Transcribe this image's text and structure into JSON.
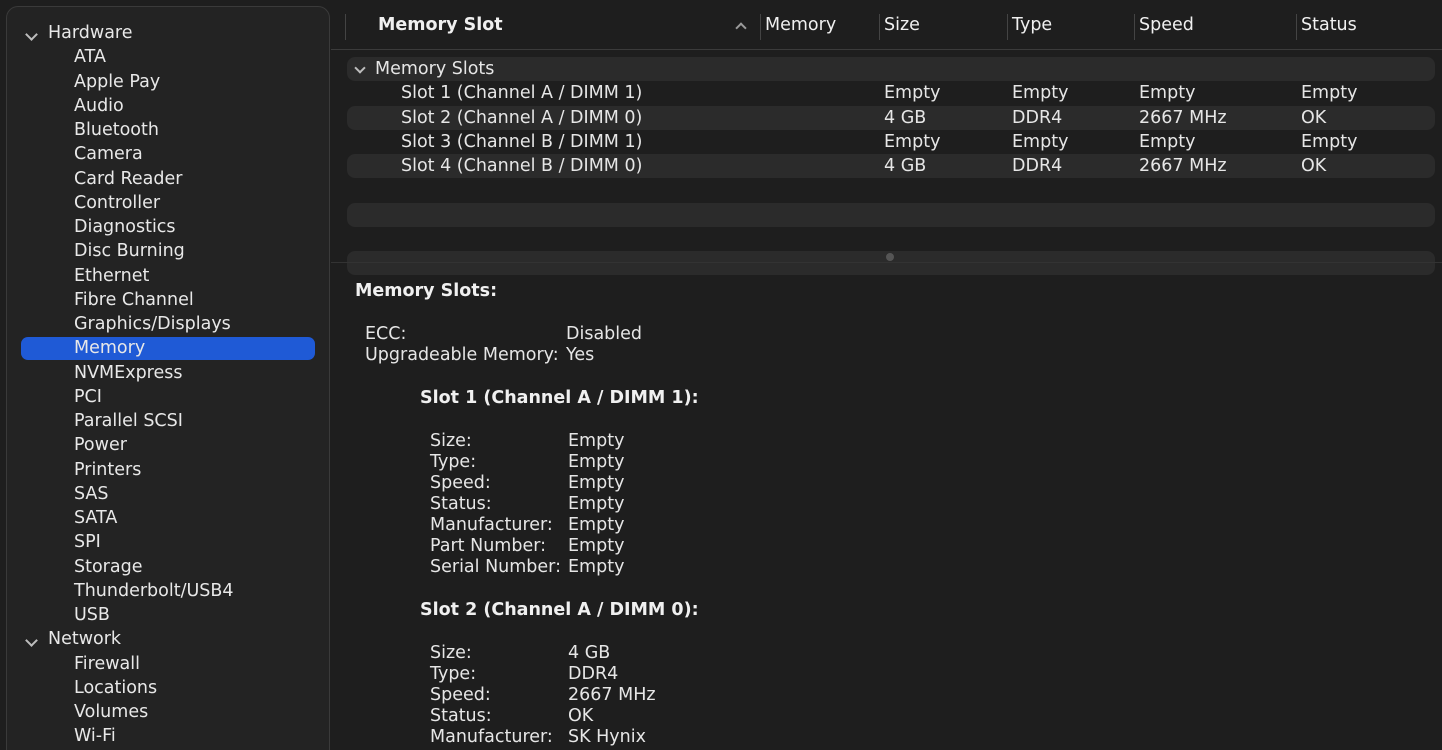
{
  "sidebar": {
    "groups": [
      {
        "label": "Hardware",
        "items": [
          "ATA",
          "Apple Pay",
          "Audio",
          "Bluetooth",
          "Camera",
          "Card Reader",
          "Controller",
          "Diagnostics",
          "Disc Burning",
          "Ethernet",
          "Fibre Channel",
          "Graphics/Displays",
          "Memory",
          "NVMExpress",
          "PCI",
          "Parallel SCSI",
          "Power",
          "Printers",
          "SAS",
          "SATA",
          "SPI",
          "Storage",
          "Thunderbolt/USB4",
          "USB"
        ]
      },
      {
        "label": "Network",
        "items": [
          "Firewall",
          "Locations",
          "Volumes",
          "Wi-Fi"
        ]
      }
    ],
    "selected": "Memory",
    "accent": "#1f5ad6"
  },
  "table": {
    "columns": [
      "Memory Slot",
      "Memory",
      "Size",
      "Type",
      "Speed",
      "Status"
    ],
    "group_label": "Memory Slots",
    "rows": [
      {
        "slot": "Slot 1 (Channel A / DIMM 1)",
        "size": "Empty",
        "type": "Empty",
        "speed": "Empty",
        "status": "Empty"
      },
      {
        "slot": "Slot 2 (Channel A / DIMM 0)",
        "size": "4 GB",
        "type": "DDR4",
        "speed": "2667 MHz",
        "status": "OK"
      },
      {
        "slot": "Slot 3 (Channel B / DIMM 1)",
        "size": "Empty",
        "type": "Empty",
        "speed": "Empty",
        "status": "Empty"
      },
      {
        "slot": "Slot 4 (Channel B / DIMM 0)",
        "size": "4 GB",
        "type": "DDR4",
        "speed": "2667 MHz",
        "status": "OK"
      }
    ]
  },
  "details": {
    "title": "Memory Slots:",
    "summary": [
      {
        "k": "ECC:",
        "v": "Disabled"
      },
      {
        "k": "Upgradeable Memory:",
        "v": "Yes"
      }
    ],
    "slot1": {
      "title": "Slot 1 (Channel A / DIMM 1):",
      "fields": [
        {
          "k": "Size:",
          "v": "Empty"
        },
        {
          "k": "Type:",
          "v": "Empty"
        },
        {
          "k": "Speed:",
          "v": "Empty"
        },
        {
          "k": "Status:",
          "v": "Empty"
        },
        {
          "k": "Manufacturer:",
          "v": "Empty"
        },
        {
          "k": "Part Number:",
          "v": "Empty"
        },
        {
          "k": "Serial Number:",
          "v": "Empty"
        }
      ]
    },
    "slot2": {
      "title": "Slot 2 (Channel A / DIMM 0):",
      "fields": [
        {
          "k": "Size:",
          "v": "4 GB"
        },
        {
          "k": "Type:",
          "v": "DDR4"
        },
        {
          "k": "Speed:",
          "v": "2667 MHz"
        },
        {
          "k": "Status:",
          "v": "OK"
        },
        {
          "k": "Manufacturer:",
          "v": "SK Hynix"
        }
      ]
    }
  }
}
